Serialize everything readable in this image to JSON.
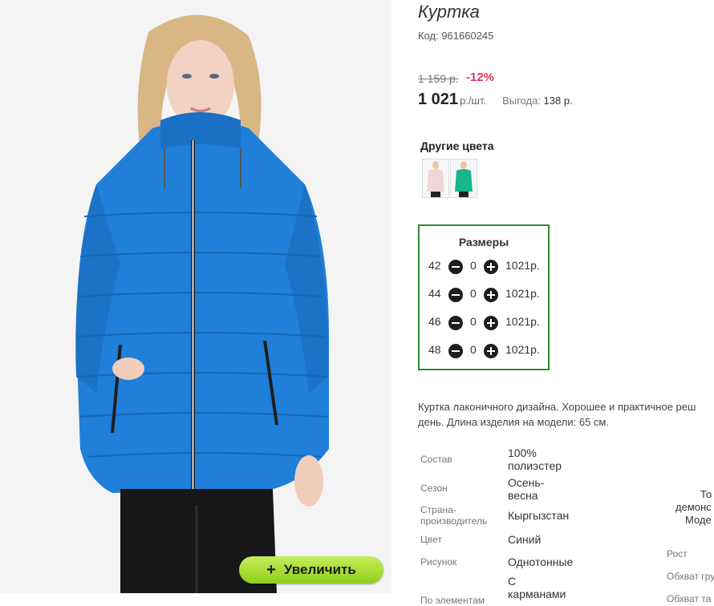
{
  "product": {
    "title": "Куртка",
    "code": "Код: 961660245",
    "old_price": "1 159 р.",
    "discount": "-12%",
    "price": "1 021",
    "unit": "р./шт.",
    "benefit_label": "Выгода:",
    "benefit_value": "138 р."
  },
  "colors": {
    "title": "Другие цвета",
    "items": [
      {
        "name": "light-pink",
        "color": "#f1d6d8"
      },
      {
        "name": "green",
        "color": "#18b58b"
      }
    ]
  },
  "sizes": {
    "title": "Размеры",
    "rows": [
      {
        "size": "42",
        "qty": "0",
        "price": "1021р."
      },
      {
        "size": "44",
        "qty": "0",
        "price": "1021р."
      },
      {
        "size": "46",
        "qty": "0",
        "price": "1021р."
      },
      {
        "size": "48",
        "qty": "0",
        "price": "1021р."
      }
    ]
  },
  "description": {
    "line1": "Куртка лаконичного дизайна. Хорошее и практичное реш",
    "line2": "день. Длина изделия на модели: 65 см."
  },
  "specs": [
    {
      "label": "Состав",
      "value": "100% полиэстер"
    },
    {
      "label": "Сезон",
      "value": "Осень-весна"
    },
    {
      "label": "Страна-производитель",
      "value": "Кыргызстан"
    },
    {
      "label": "Цвет",
      "value": "Синий"
    },
    {
      "label": "Рисунок",
      "value": "Однотонные"
    },
    {
      "label": "По элементам",
      "value": "С карманами"
    }
  ],
  "right_specs": {
    "value1": "То",
    "value2": "демонс",
    "value3": "Моде",
    "label1": "Рост",
    "label2": "Обхват гру",
    "label3": "Обхват та"
  },
  "zoom_button": {
    "label": "Увеличить",
    "icon": "plus-icon"
  },
  "accent": {
    "jacket": "#1f7fd9",
    "frame": "#2e8b2e",
    "discount": "#e0345b",
    "button": "#a6dc2e"
  }
}
